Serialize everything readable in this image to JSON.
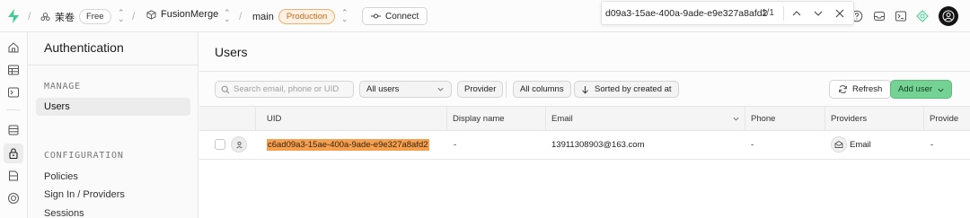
{
  "topbar": {
    "org_name": "茉卷",
    "org_plan": "Free",
    "project_name": "FusionMerge",
    "branch_name": "main",
    "branch_env": "Production",
    "connect_label": "Connect"
  },
  "find_bar": {
    "query": "d09a3-15ae-400a-9ade-e9e327a8afd2",
    "count": "1/1"
  },
  "sidebar": {
    "title": "Authentication",
    "manage_label": "MANAGE",
    "manage_items": [
      {
        "label": "Users",
        "active": true
      }
    ],
    "configuration_label": "CONFIGURATION",
    "configuration_items": [
      {
        "label": "Policies"
      },
      {
        "label": "Sign In / Providers"
      },
      {
        "label": "Sessions"
      }
    ]
  },
  "main": {
    "title": "Users",
    "search_placeholder": "Search email, phone or UID",
    "filter_users": "All users",
    "provider_label": "Provider",
    "columns_label": "All columns",
    "sort_label": "Sorted by created at",
    "refresh_label": "Refresh",
    "add_user_label": "Add user"
  },
  "table": {
    "columns": [
      "UID",
      "Display name",
      "Email",
      "Phone",
      "Providers",
      "Provide"
    ],
    "rows": [
      {
        "uid": "c6ad09a3-15ae-400a-9ade-e9e327a8afd2",
        "display_name": "-",
        "email": "13911308903@163.com",
        "phone": "-",
        "provider": "Email",
        "provider_extra": "-"
      }
    ]
  },
  "colors": {
    "accent_green": "#74d394",
    "production_orange": "#f2b173",
    "highlight": "#f4a04f"
  }
}
